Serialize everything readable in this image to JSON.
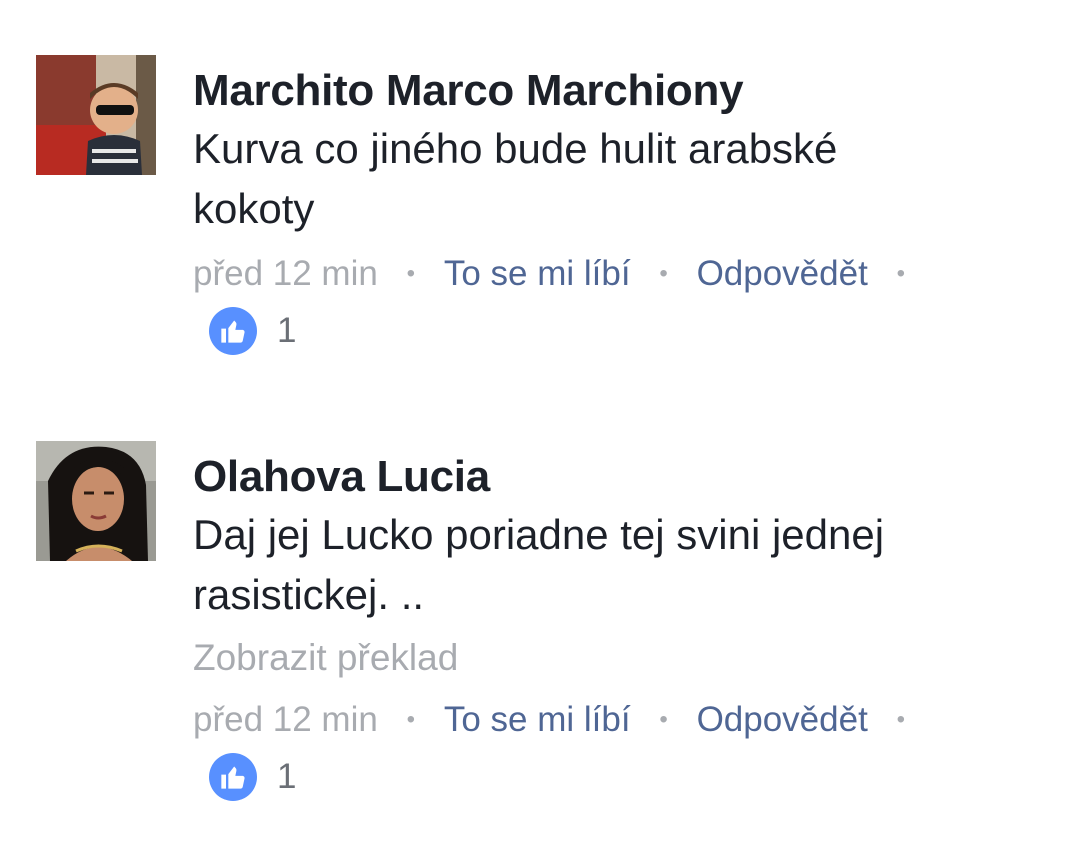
{
  "comments": [
    {
      "author": "Marchito Marco Marchiony",
      "text": "Kurva co jiného bude hulit arabské\nkokoty",
      "translate_label": "",
      "time": "před 12 min",
      "like_label": "To se mi líbí",
      "reply_label": "Odpovědět",
      "like_count": "1",
      "avatar_icon": "avatar-boy-sunglasses"
    },
    {
      "author": "Olahova Lucia",
      "text": "Daj jej Lucko poriadne tej svini jednej\nrasistickej. ..",
      "translate_label": "Zobrazit překlad",
      "time": "před 12 min",
      "like_label": "To se mi líbí",
      "reply_label": "Odpovědět",
      "like_count": "1",
      "avatar_icon": "avatar-woman"
    }
  ],
  "colors": {
    "author": "#1d2129",
    "meta_gray": "#a8abb0",
    "link_blue": "#4f6694",
    "like_badge": "#5890ff"
  },
  "separator": "•"
}
